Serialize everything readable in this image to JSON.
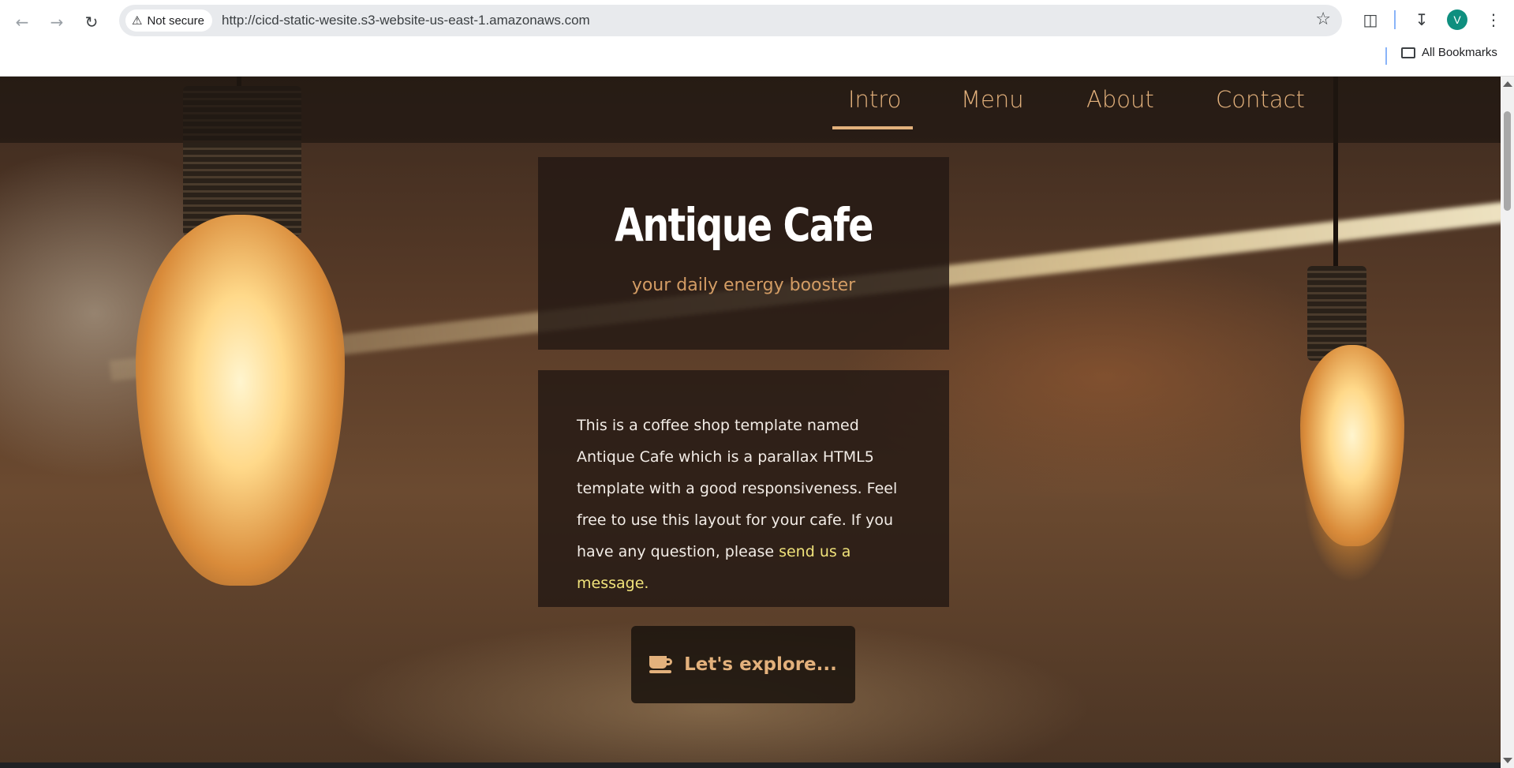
{
  "browser": {
    "security_label": "Not secure",
    "url": "http://cicd-static-wesite.s3-website-us-east-1.amazonaws.com",
    "profile_initial": "V",
    "bookmarks_label": "All Bookmarks",
    "icons": [
      "back-arrow-icon",
      "forward-arrow-icon",
      "reload-icon",
      "warning-icon",
      "star-icon",
      "extensions-icon",
      "download-icon",
      "kebab-menu-icon",
      "folder-icon"
    ]
  },
  "site": {
    "nav": [
      {
        "label": "Intro",
        "active": true
      },
      {
        "label": "Menu"
      },
      {
        "label": "About"
      },
      {
        "label": "Contact"
      }
    ],
    "title": "Antique Cafe",
    "subtitle": "your daily energy booster",
    "description": "This is a coffee shop template named Antique Cafe which is a parallax HTML5 template with a good responsiveness. Feel free to use this layout for your cafe. If you have any question, please ",
    "link_text": "send us a message.",
    "cta_label": "Let's explore...",
    "colors": {
      "accent": "#e3b17c",
      "link": "#f0e27a",
      "panel": "#231914"
    }
  }
}
